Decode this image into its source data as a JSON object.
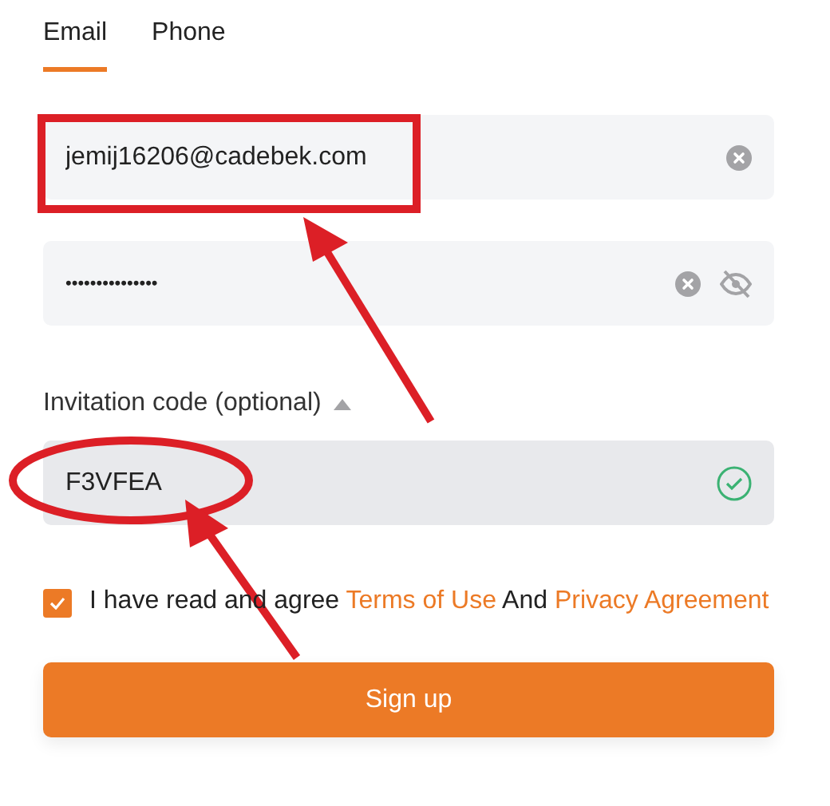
{
  "tabs": [
    {
      "label": "Email",
      "selected": true
    },
    {
      "label": "Phone",
      "selected": false
    }
  ],
  "email": {
    "value": "jemij16206@cadebek.com"
  },
  "password": {
    "value": "•••••••••••••••",
    "visible": false
  },
  "invitation": {
    "label": "Invitation code (optional)",
    "expanded": true,
    "value": "F3VFEA",
    "valid": true
  },
  "agreement": {
    "checked": true,
    "text": "I have read and agree",
    "link_1": "Terms of Use",
    "joiner": "And",
    "link_2": "Privacy Agreement"
  },
  "submit": {
    "label": "Sign up"
  }
}
